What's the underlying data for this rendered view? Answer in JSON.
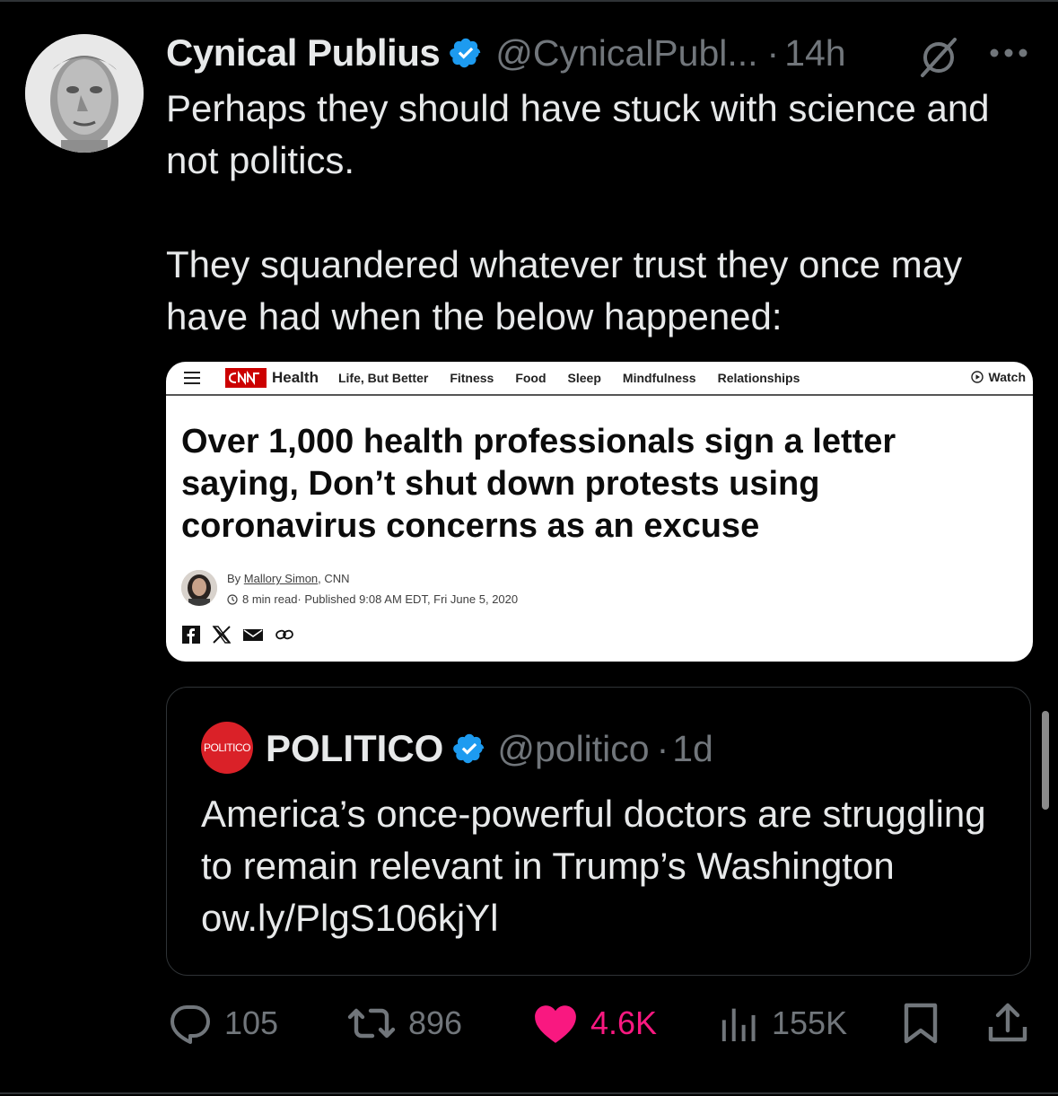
{
  "tweet": {
    "author_name": "Cynical Publius",
    "author_handle": "@CynicalPubl...",
    "separator": "·",
    "time": "14h",
    "text_paragraphs": [
      "Perhaps they should have stuck with science and not politics.",
      "They squandered whatever trust they once may have had when the below happened:"
    ]
  },
  "cnn_screenshot": {
    "section": "Health",
    "nav_items": [
      "Life, But Better",
      "Fitness",
      "Food",
      "Sleep",
      "Mindfulness",
      "Relationships"
    ],
    "watch_label": "Watch",
    "headline": "Over 1,000 health professionals sign a letter saying, Don’t shut down protests using coronavirus concerns as an excuse",
    "byline_prefix": "By ",
    "author": "Mallory Simon",
    "byline_suffix": ", CNN",
    "read_time": "8 min read",
    "published": " · Published 9:08 AM EDT, Fri June 5, 2020"
  },
  "quoted_tweet": {
    "logo_text": "POLITICO",
    "author_name": "POLITICO",
    "author_handle": "@politico",
    "separator": "·",
    "time": "1d",
    "text": "America’s once-powerful doctors are struggling to remain relevant in Trump’s Washington ow.ly/PlgS106kjYl"
  },
  "actions": {
    "replies": "105",
    "reposts": "896",
    "likes": "4.6K",
    "views": "155K"
  },
  "colors": {
    "background": "#000000",
    "text": "#e7e9ea",
    "muted": "#71767b",
    "verified": "#1d9bf0",
    "like": "#f91880",
    "cnn_red": "#cc0000",
    "politico_red": "#da2128"
  },
  "icons": [
    "verified-icon",
    "grok-icon",
    "more-icon",
    "reply-icon",
    "repost-icon",
    "heart-icon",
    "views-icon",
    "bookmark-icon",
    "share-icon"
  ]
}
